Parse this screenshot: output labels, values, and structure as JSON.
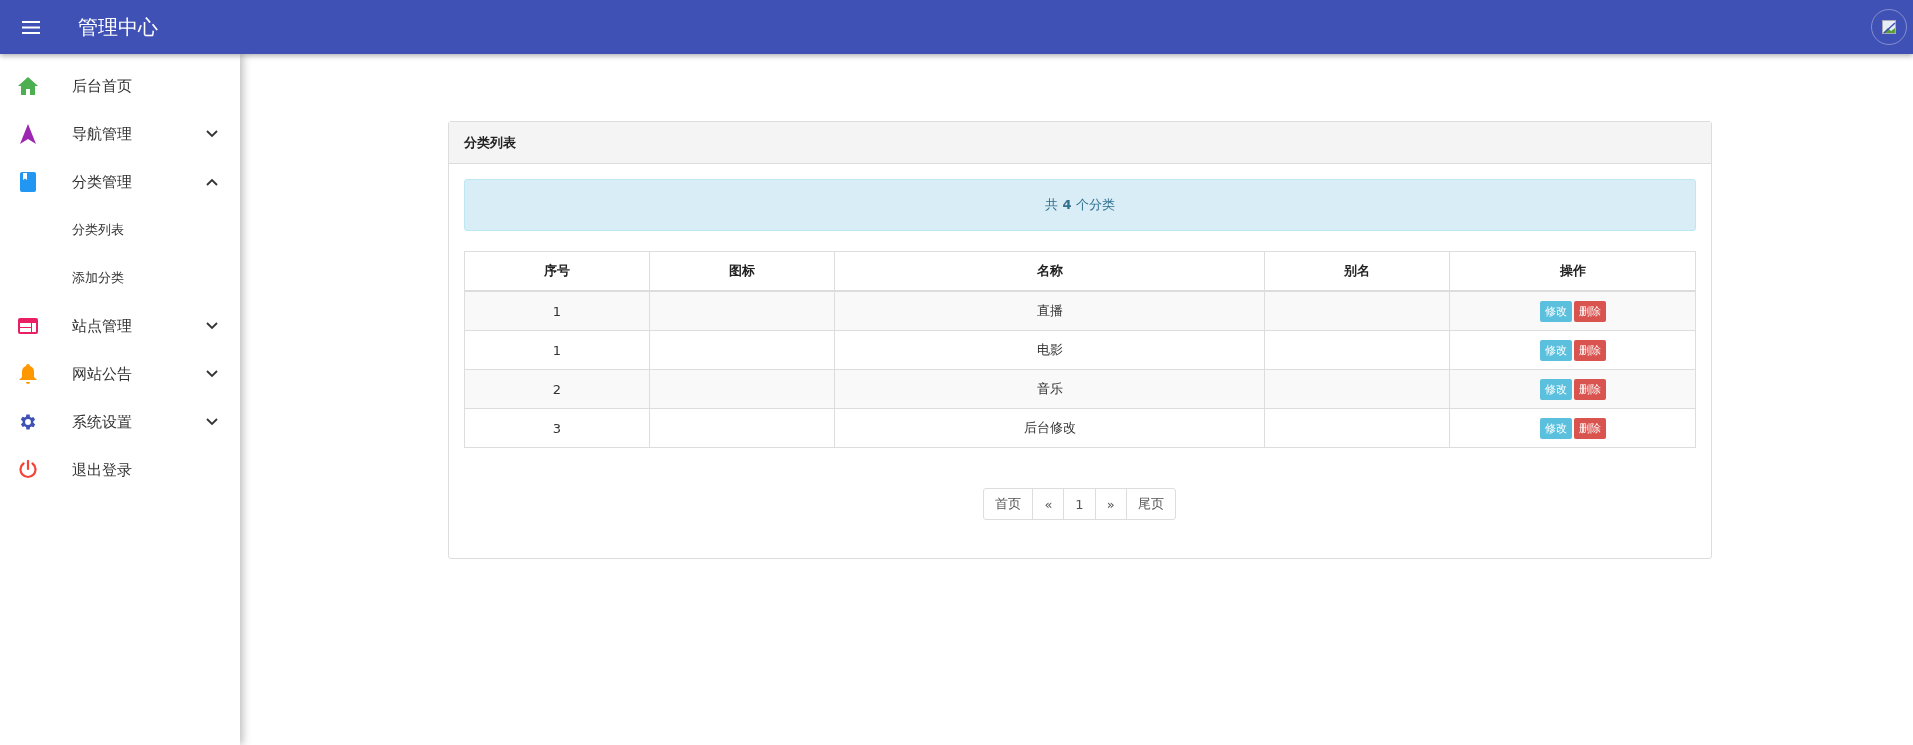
{
  "header": {
    "title": "管理中心"
  },
  "sidebar": {
    "items": [
      {
        "label": "后台首页"
      },
      {
        "label": "导航管理",
        "expanded": false
      },
      {
        "label": "分类管理",
        "expanded": true,
        "children": [
          {
            "label": "分类列表"
          },
          {
            "label": "添加分类"
          }
        ]
      },
      {
        "label": "站点管理",
        "expanded": false
      },
      {
        "label": "网站公告",
        "expanded": false
      },
      {
        "label": "系统设置",
        "expanded": false
      },
      {
        "label": "退出登录"
      }
    ]
  },
  "card": {
    "title": "分类列表",
    "alert": "共 **4** 个分类",
    "table": {
      "columns": [
        "序号",
        "图标",
        "名称",
        "别名",
        "操作"
      ],
      "rows": [
        {
          "index": "1",
          "name": "直播",
          "actions": [
            "修改",
            "删除"
          ]
        },
        {
          "index": "1",
          "name": "电影",
          "actions": [
            "修改",
            "删除"
          ]
        },
        {
          "index": "2",
          "name": "音乐",
          "actions": [
            "修改",
            "删除"
          ]
        },
        {
          "index": "3",
          "name": "后台修改",
          "actions": [
            "修改",
            "删除"
          ]
        }
      ]
    },
    "pagination": [
      "首页",
      "«",
      "1",
      "»",
      "尾页"
    ]
  }
}
